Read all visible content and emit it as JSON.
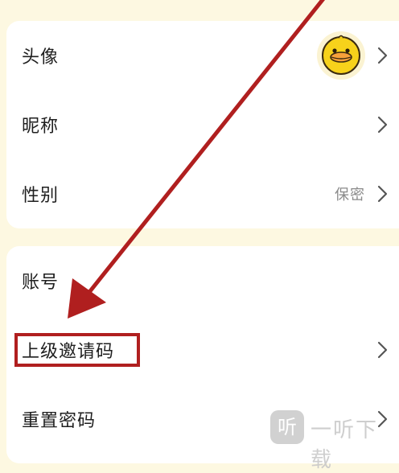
{
  "profile": {
    "avatar_label": "头像",
    "nickname_label": "昵称",
    "gender_label": "性别",
    "gender_value": "保密"
  },
  "account": {
    "account_label": "账号",
    "inviter_code_label": "上级邀请码",
    "reset_password_label": "重置密码"
  },
  "watermark": {
    "logo_char": "听",
    "text": "一听下载"
  },
  "colors": {
    "background": "#fdf8e1",
    "card": "#ffffff",
    "annotation": "#b01f1f",
    "avatar_yellow": "#f7d21b"
  }
}
